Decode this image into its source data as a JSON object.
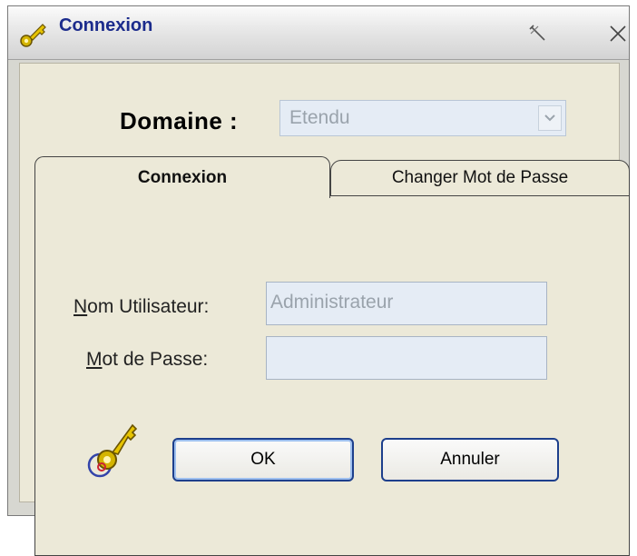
{
  "window": {
    "title": "Connexion"
  },
  "form": {
    "domaine_label": "Domaine :",
    "domaine_value": "Etendu"
  },
  "tabs": [
    {
      "label": "Connexion",
      "active": true
    },
    {
      "label": "Changer Mot de Passe",
      "active": false
    }
  ],
  "login": {
    "user_label_first": "N",
    "user_label_rest": "om Utilisateur:",
    "user_value": "Administrateur",
    "pass_label_first": "M",
    "pass_label_rest": "ot de Passe:",
    "pass_value": ""
  },
  "buttons": {
    "ok": "OK",
    "cancel": "Annuler"
  },
  "icons": {
    "title": "key-icon",
    "pin": "pin-icon",
    "close": "close-icon",
    "footer": "keys-icon"
  },
  "colors": {
    "title_text": "#1b2b8c",
    "field_bg": "#e5ecf5",
    "panel_bg": "#ece9d8",
    "focus_border": "#1d3f8c"
  }
}
